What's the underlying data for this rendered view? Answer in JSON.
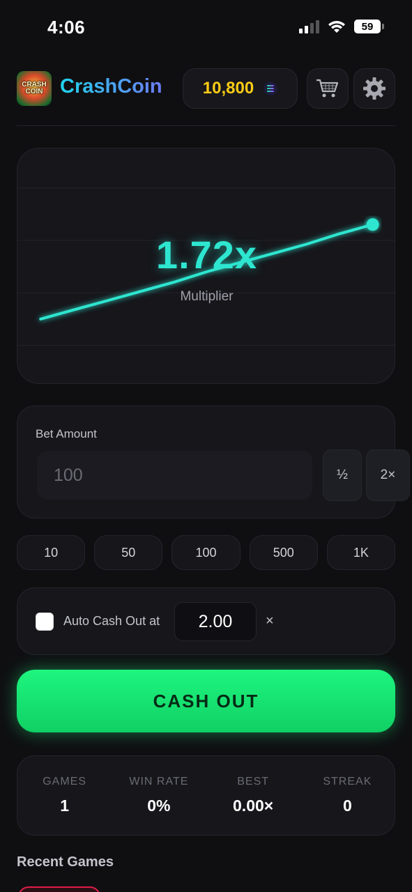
{
  "status_bar": {
    "time": "4:06",
    "battery": "59"
  },
  "header": {
    "app_title": "CrashCoin",
    "logo_text": "CRASH COIN",
    "balance": "10,800"
  },
  "game": {
    "multiplier": "1.72x",
    "multiplier_label": "Multiplier",
    "chart_data": {
      "type": "line",
      "series": [
        {
          "x": [
            0.0,
            0.1,
            0.2,
            0.3,
            0.4,
            0.5,
            0.6,
            0.7,
            0.8,
            0.9,
            1.0
          ],
          "y": [
            1.0,
            1.07,
            1.14,
            1.21,
            1.28,
            1.36,
            1.43,
            1.5,
            1.57,
            1.65,
            1.72
          ]
        }
      ],
      "ylim": [
        0.5,
        2.3
      ],
      "xlim": [
        -0.07,
        1.07
      ],
      "grid": true,
      "line_color": "#2ee6d0"
    }
  },
  "bet": {
    "label": "Bet Amount",
    "placeholder": "100",
    "half_label": "½",
    "double_label": "2×"
  },
  "quick_amounts": [
    "10",
    "50",
    "100",
    "500",
    "1K"
  ],
  "auto_cashout": {
    "label": "Auto Cash Out at",
    "value": "2.00",
    "suffix": "×",
    "enabled": false
  },
  "cashout_label": "CASH OUT",
  "stats": [
    {
      "label": "GAMES",
      "value": "1"
    },
    {
      "label": "WIN RATE",
      "value": "0%"
    },
    {
      "label": "BEST",
      "value": "0.00×"
    },
    {
      "label": "STREAK",
      "value": "0"
    }
  ],
  "recent_title": "Recent Games"
}
